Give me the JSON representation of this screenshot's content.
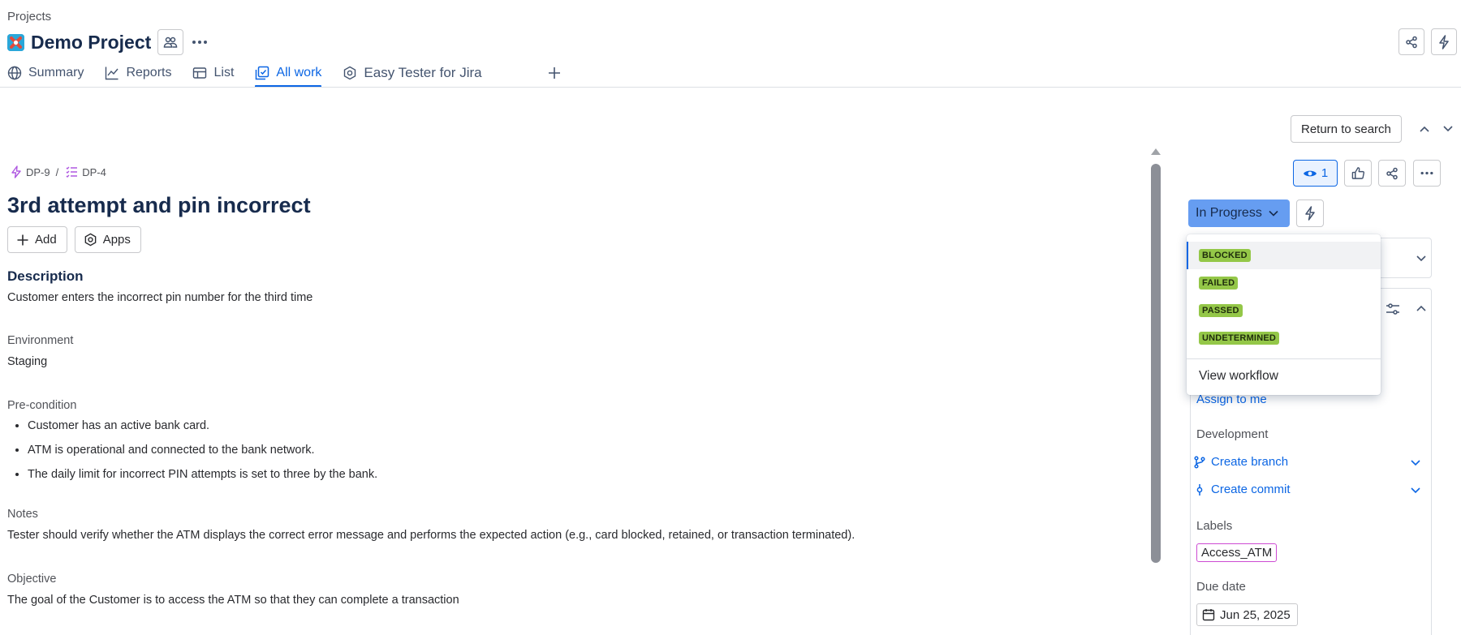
{
  "header": {
    "breadcrumb": "Projects",
    "project_title": "Demo Project"
  },
  "tabs": [
    {
      "label": "Summary",
      "icon": "globe-icon"
    },
    {
      "label": "Reports",
      "icon": "chart-line-icon"
    },
    {
      "label": "List",
      "icon": "table-icon"
    },
    {
      "label": "All work",
      "icon": "stacked-issues-icon",
      "active": true
    },
    {
      "label": "Easy Tester for Jira",
      "icon": "app-hexagon-icon"
    }
  ],
  "return_to_search": "Return to search",
  "issue": {
    "parent_key": "DP-9",
    "separator": "/",
    "key": "DP-4",
    "title": "3rd attempt and pin incorrect",
    "add_label": "Add",
    "apps_label": "Apps",
    "description_heading": "Description",
    "description": "Customer enters the incorrect pin number for the third time",
    "environment_heading": "Environment",
    "environment": "Staging",
    "precondition_heading": "Pre-condition",
    "preconditions": [
      "Customer has an active bank card.",
      "ATM is operational and connected to the bank network.",
      "The daily limit for incorrect PIN attempts is set to three by the bank."
    ],
    "notes_heading": "Notes",
    "notes": "Tester should verify whether the ATM displays the correct error message and performs the expected action (e.g., card blocked, retained, or transaction terminated).",
    "objective_heading": "Objective",
    "objective": "The goal of the Customer is to access the ATM so that they can complete a transaction"
  },
  "sidebar": {
    "watchers_count": "1",
    "status": "In Progress",
    "assign_to_me": "Assign to me",
    "development_heading": "Development",
    "create_branch": "Create branch",
    "create_commit": "Create commit",
    "labels_heading": "Labels",
    "label_value": "Access_ATM",
    "due_date_heading": "Due date",
    "due_date": "Jun 25, 2025"
  },
  "status_dropdown": {
    "options": [
      "BLOCKED",
      "FAILED",
      "PASSED",
      "UNDETERMINED"
    ],
    "lozenge_color": "#94C748",
    "view_workflow": "View workflow"
  },
  "colors": {
    "accent": "#0C66E4",
    "status_button": "#669DF1"
  }
}
